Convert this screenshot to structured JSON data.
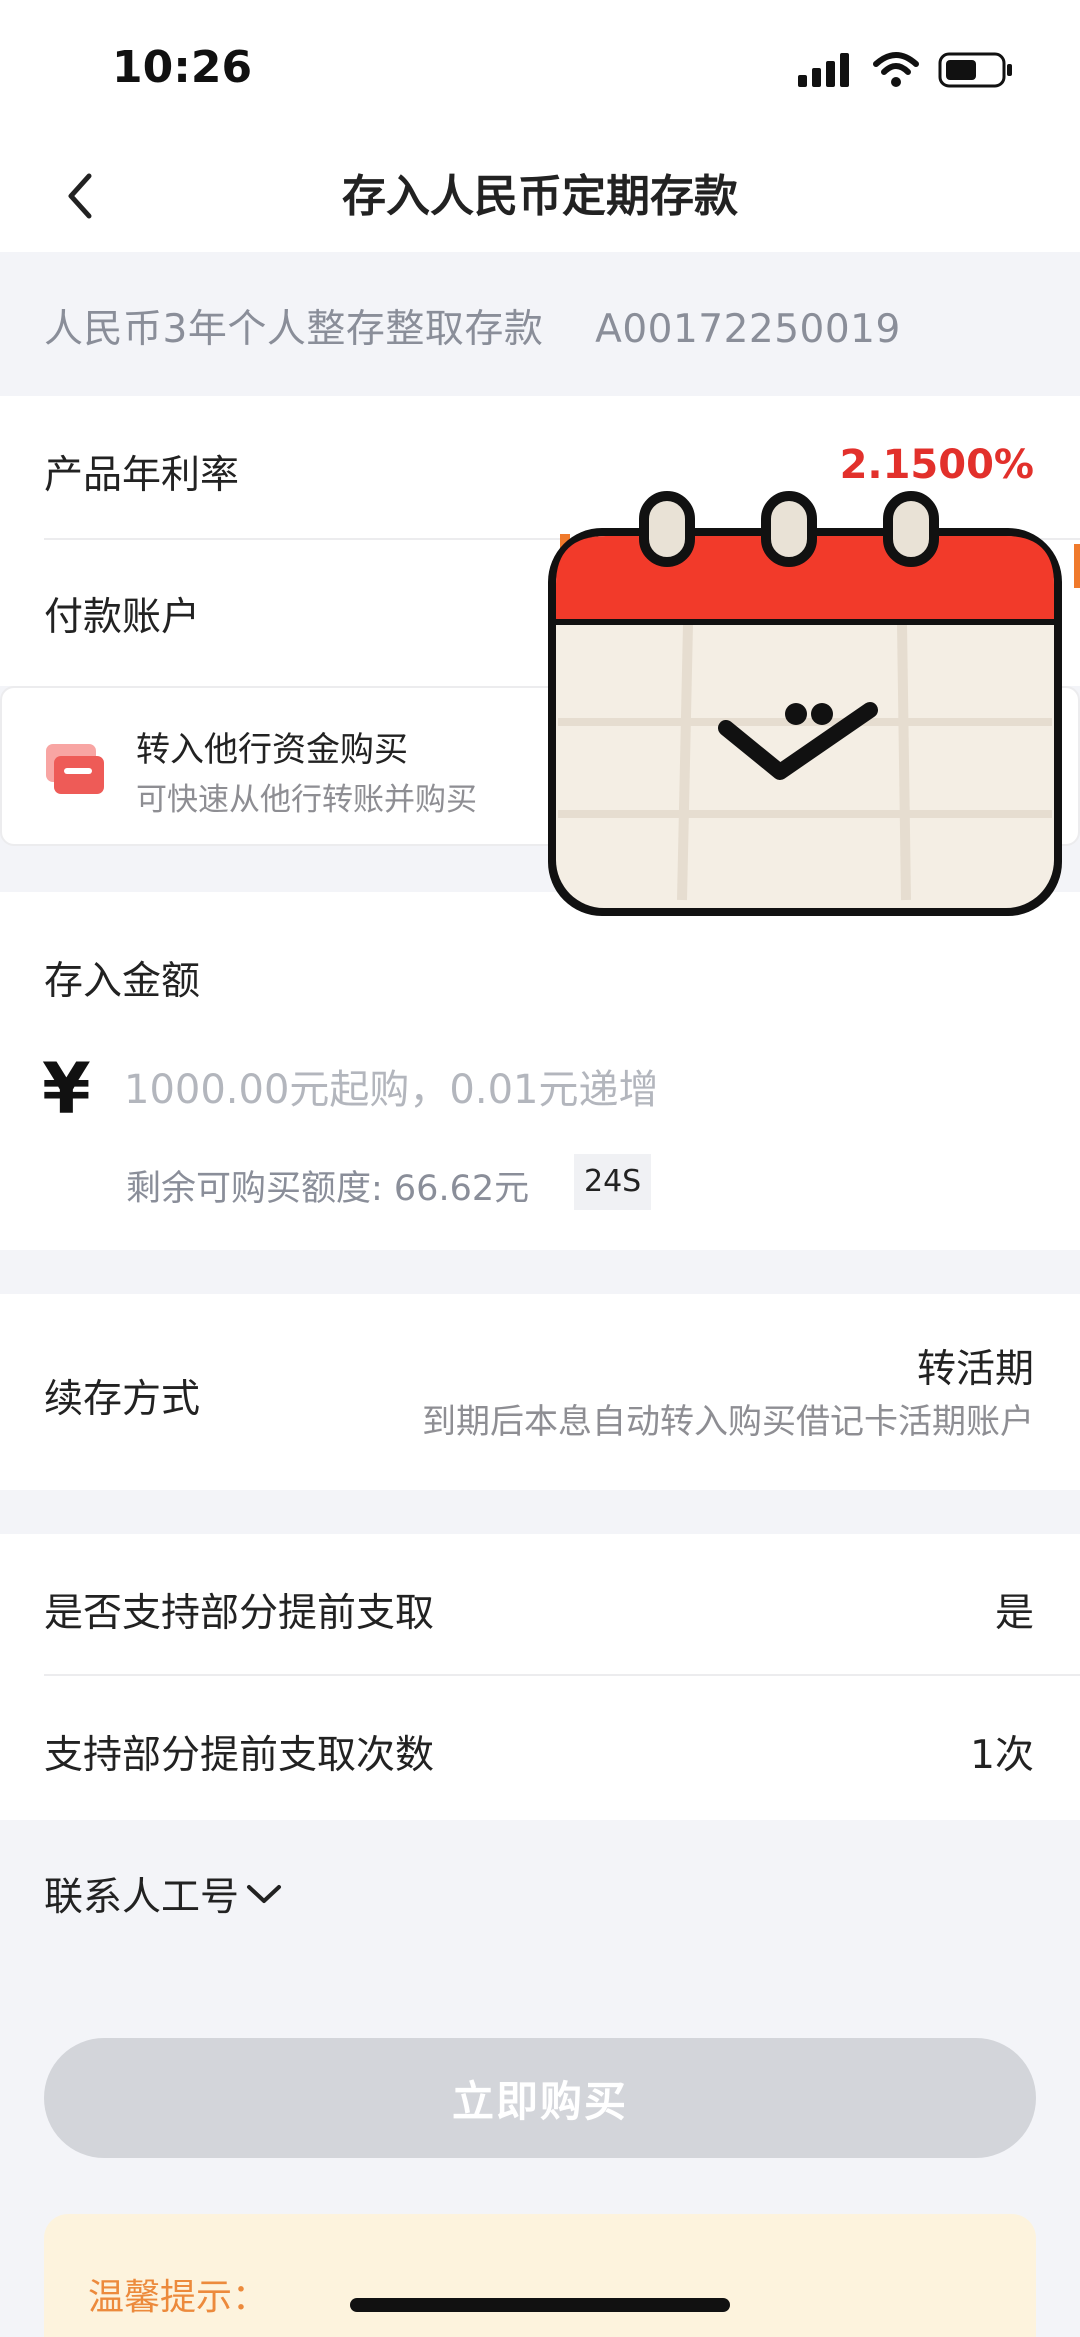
{
  "status_bar": {
    "time": "10:26"
  },
  "nav": {
    "title": "存入人民币定期存款"
  },
  "product": {
    "name": "人民币3年个人整存整取存款",
    "code": "A00172250019"
  },
  "rate": {
    "label": "产品年利率",
    "value": "2.1500%"
  },
  "payment": {
    "label": "付款账户"
  },
  "transfer": {
    "title": "转入他行资金购买",
    "subtitle": "可快速从他行转账并购买"
  },
  "amount": {
    "title": "存入金额",
    "currency_symbol": "¥",
    "placeholder": "1000.00元起购，0.01元递增",
    "remaining": "剩余可购买额度: 66.62元",
    "tag": "24S"
  },
  "renew": {
    "label": "续存方式",
    "value": "转活期",
    "description": "到期后本息自动转入购买借记卡活期账户"
  },
  "withdraw": {
    "partial_label": "是否支持部分提前支取",
    "partial_value": "是",
    "count_label": "支持部分提前支取次数",
    "count_value": "1次"
  },
  "contact": {
    "label": "联系人工号"
  },
  "actions": {
    "buy_label": "立即购买"
  },
  "tips": {
    "title": "温馨提示："
  },
  "colors": {
    "accent_red": "#e2302b",
    "button_disabled": "#d3d5da",
    "tips_bg": "#fdf3dd",
    "tips_text": "#ec8a3c"
  },
  "icons": [
    "back-arrow-icon",
    "signal-icon",
    "wifi-icon",
    "battery-icon",
    "bank-card-icon",
    "chevron-down-icon",
    "calendar-sticker"
  ]
}
